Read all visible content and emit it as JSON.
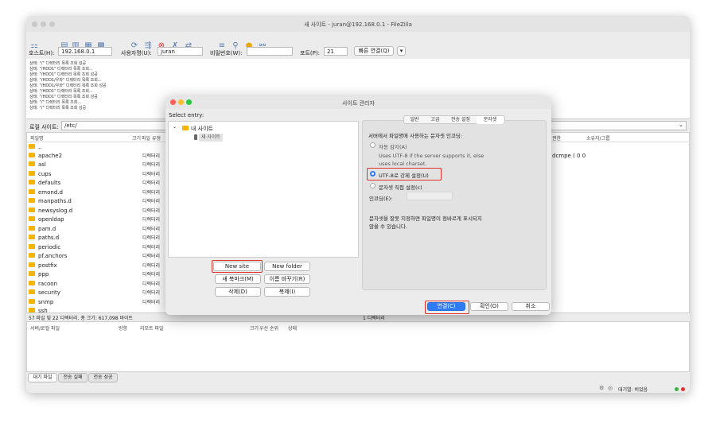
{
  "window": {
    "title": "새 사이트 - juran@192.168.0.1 - FileZilla"
  },
  "quickconnect": {
    "host_label": "호스트(H):",
    "host_value": "192.168.0.1",
    "user_label": "사용자명(U):",
    "user_value": "juran",
    "pass_label": "비밀번호(W):",
    "pass_value": "",
    "port_label": "포트(P):",
    "port_value": "21",
    "connect_label": "빠른 연결(Q)",
    "dropdown": "▾"
  },
  "log": [
    "상태: \"/\" 디렉터리 목록 조회 성공",
    "상태: \"/HDD1\" 디렉터리 목록 조회...",
    "상태: \"/HDD1\" 디렉터리 목록 조회 성공",
    "상태: \"/HDD1/우와\" 디렉터리 목록 조회...",
    "상태: \"/HDD1/우와\" 디렉터리 목록 조회 성공",
    "상태: \"/HDD1\" 디렉터리 목록 조회...",
    "상태: \"/HDD1\" 디렉터리 목록 조회 성공",
    "상태: \"/\" 디렉터리 목록 조회...",
    "상태: \"/\" 디렉터리 목록 조회 성공"
  ],
  "local": {
    "site_label": "로컬 사이트:",
    "path": "/etc/",
    "col_name": "파일명",
    "col_size": "크기",
    "col_type": "파일 유형",
    "files": [
      "..",
      "apache2",
      "asl",
      "cups",
      "defaults",
      "emond.d",
      "manpaths.d",
      "newsyslog.d",
      "openldap",
      "pam.d",
      "paths.d",
      "periodic",
      "pf.anchors",
      "postfix",
      "ppp",
      "racoon",
      "security",
      "snmp",
      "ssh"
    ],
    "folder_type": "디렉터리",
    "summary": "57 파일 및 22 디렉터리. 총 크기: 617,098 바이트"
  },
  "remote": {
    "col_perm": "권한",
    "col_owner": "소유자/그룹",
    "row_text": "dcmpe ( 0 0",
    "summary": "1 디렉터리"
  },
  "queue": {
    "col_server": "서버/로컬 파일",
    "col_dir": "방향",
    "col_remote": "리모트 파일",
    "col_size": "크기",
    "col_priority": "우선 순위",
    "col_status": "상태",
    "tabs": [
      "대기 파일",
      "전송 실패",
      "전송 성공"
    ],
    "status_text": "대기열: 비었음"
  },
  "dialog": {
    "title": "사이트 관리자",
    "select_entry": "Select entry:",
    "tree_root": "내 사이트",
    "tree_child": "새 사이트",
    "tabs": [
      "일반",
      "고급",
      "전송 설정",
      "문자셋"
    ],
    "heading": "서버에서 파일명에 사용하는 문자셋 인코딩:",
    "opt_auto": "자동 감지(A)",
    "opt_auto_desc1": "Uses UTF-8 if the server supports it, else",
    "opt_auto_desc2": "uses local charset.",
    "opt_utf8": "UTF-8로 강제 설정(U)",
    "opt_custom": "문자셋 직접 설정(c)",
    "encoding_label": "인코딩(E):",
    "note1": "문자셋을 잘못 지정하면 파일명이 정바르게 표시되지",
    "note2": "않을 수 있습니다.",
    "btn_new_site": "New site",
    "btn_new_folder": "New folder",
    "btn_bookmark": "새 북마크(M)",
    "btn_rename": "이름 바꾸기(R)",
    "btn_delete": "삭제(D)",
    "btn_copy": "복제(I)",
    "btn_connect": "연결(C)",
    "btn_ok": "확인(O)",
    "btn_cancel": "취소"
  },
  "colors": {
    "accent": "#2f7bf5",
    "highlight": "#e0302a",
    "folder": "#f4b400"
  }
}
